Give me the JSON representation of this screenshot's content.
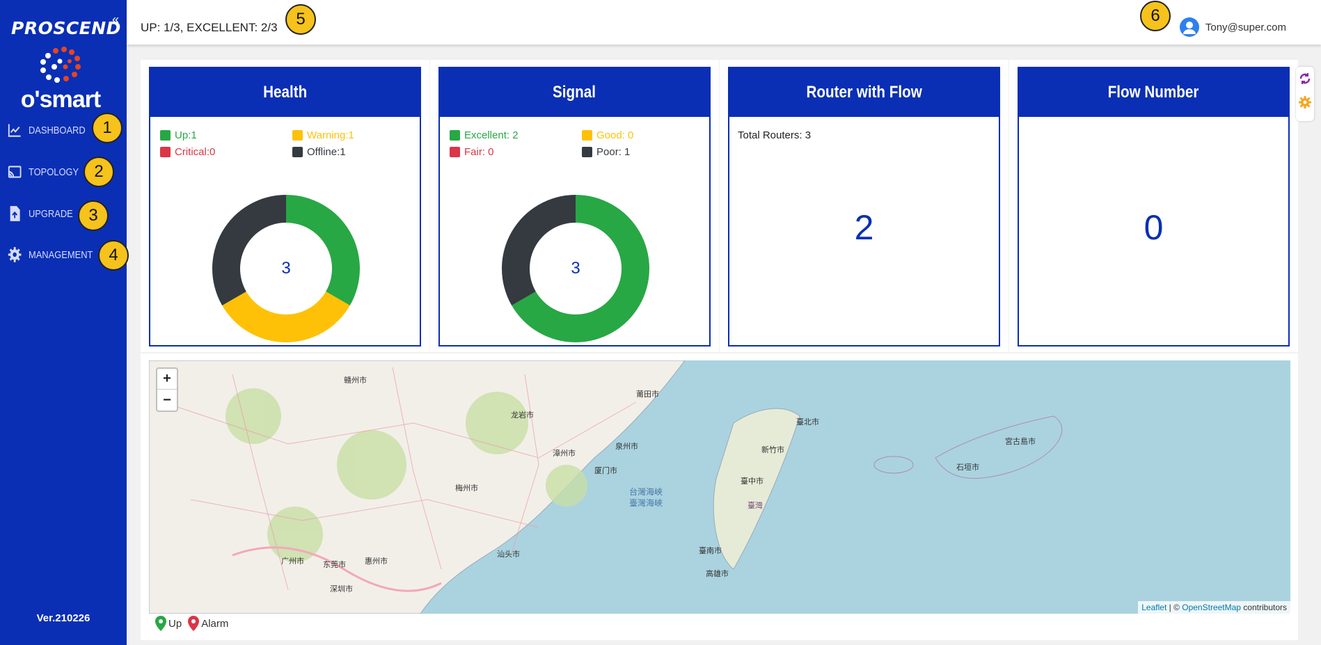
{
  "sidebar": {
    "brand": "PROSCEND",
    "logo_text": "o'smart",
    "collapse_icon": "«",
    "items": [
      {
        "label": "DASHBOARD",
        "icon": "chart-line-icon",
        "badge": "1"
      },
      {
        "label": "TOPOLOGY",
        "icon": "cast-icon",
        "badge": "2"
      },
      {
        "label": "UPGRADE",
        "icon": "file-upload-icon",
        "badge": "3"
      },
      {
        "label": "MANAGEMENT",
        "icon": "gear-icon",
        "badge": "4"
      }
    ],
    "version": "Ver.210226"
  },
  "topbar": {
    "status": "UP: 1/3, EXCELLENT: 2/3",
    "status_badge": "5",
    "user_badge": "6",
    "user": "Tony@super.com"
  },
  "cards": {
    "health": {
      "title": "Health",
      "legend": [
        {
          "label": "Up:1",
          "color": "#28a745"
        },
        {
          "label": "Warning:1",
          "color": "#ffc107"
        },
        {
          "label": "Critical:0",
          "color": "#dc3545"
        },
        {
          "label": "Offline:1",
          "color": "#343a40"
        }
      ],
      "total": "3"
    },
    "signal": {
      "title": "Signal",
      "legend": [
        {
          "label": "Excellent: 2",
          "color": "#28a745"
        },
        {
          "label": "Good: 0",
          "color": "#ffc107"
        },
        {
          "label": "Fair: 0",
          "color": "#dc3545"
        },
        {
          "label": "Poor: 1",
          "color": "#343a40"
        }
      ],
      "total": "3"
    },
    "router_flow": {
      "title": "Router with Flow",
      "total_label": "Total Routers: 3",
      "value": "2"
    },
    "flow_number": {
      "title": "Flow Number",
      "value": "0"
    }
  },
  "chart_data": [
    {
      "type": "pie",
      "title": "Health",
      "categories": [
        "Up",
        "Warning",
        "Critical",
        "Offline"
      ],
      "values": [
        1,
        1,
        0,
        1
      ],
      "colors": [
        "#28a745",
        "#ffc107",
        "#dc3545",
        "#343a40"
      ],
      "center_label": "3"
    },
    {
      "type": "pie",
      "title": "Signal",
      "categories": [
        "Excellent",
        "Good",
        "Fair",
        "Poor"
      ],
      "values": [
        2,
        0,
        0,
        1
      ],
      "colors": [
        "#28a745",
        "#ffc107",
        "#dc3545",
        "#343a40"
      ],
      "center_label": "3"
    }
  ],
  "map": {
    "zoom_in": "+",
    "zoom_out": "−",
    "attribution_leaflet": "Leaflet",
    "attribution_sep": " | © ",
    "attribution_osm": "OpenStreetMap",
    "attribution_tail": " contributors",
    "labels": [
      "赣州市",
      "龙岩市",
      "漳州市",
      "厦门市",
      "泉州市",
      "莆田市",
      "广州市",
      "东莞市",
      "深圳市",
      "惠州市",
      "汕头市",
      "梅州市",
      "臺北市",
      "新竹市",
      "臺中市",
      "臺南市",
      "高雄市",
      "台灣海峽",
      "臺灣海峽",
      "石垣市",
      "宮古島市",
      "臺灣"
    ],
    "legend": [
      {
        "label": "Up",
        "color": "#28a745"
      },
      {
        "label": "Alarm",
        "color": "#dc3545"
      }
    ]
  },
  "tools": [
    {
      "icon": "refresh-icon",
      "color": "#8e24aa"
    },
    {
      "icon": "settings-icon",
      "color": "#f5a623"
    }
  ]
}
